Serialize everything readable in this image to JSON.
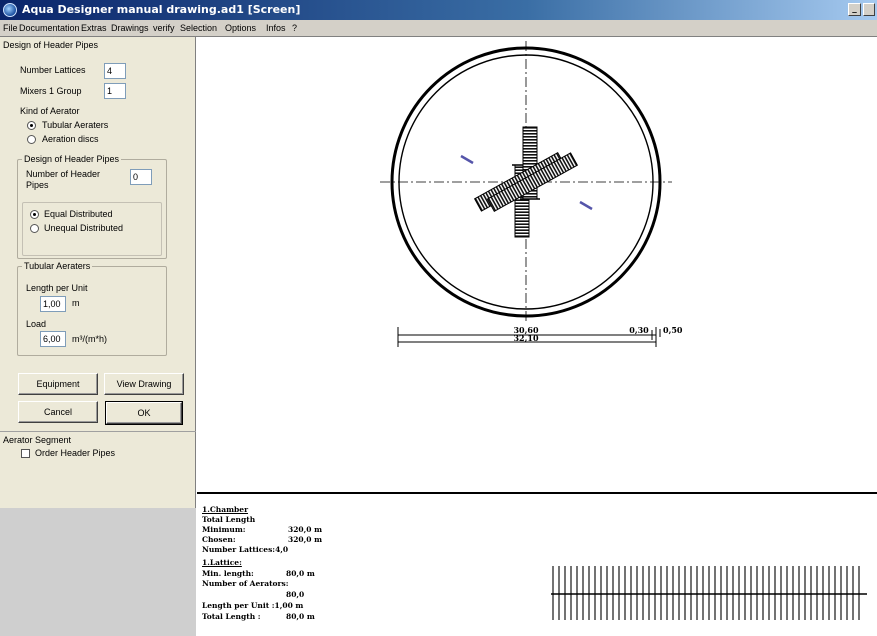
{
  "window": {
    "title": "Aqua Designer manual drawing.ad1   [Screen]",
    "min_glyph": "_"
  },
  "menu": [
    "File",
    "Documentation",
    "Extras",
    "Drawings",
    "verify",
    "Selection",
    "Options",
    "Infos",
    "?"
  ],
  "panel": {
    "heading": "Design of Header Pipes",
    "number_lattices_label": "Number Lattices",
    "number_lattices_value": "4",
    "mixers_label": "Mixers 1 Group",
    "mixers_value": "1",
    "kind_label": "Kind of Aerator",
    "kind_options": [
      {
        "label": "Tubular Aeraters",
        "selected": true
      },
      {
        "label": "Aeration discs",
        "selected": false
      }
    ],
    "header_group": {
      "title": "Design of Header Pipes",
      "number_label_1": "Number of Header",
      "number_label_2": "Pipes",
      "number_value": "0",
      "dist_options": [
        {
          "label": "Equal Distributed",
          "selected": true
        },
        {
          "label": "Unequal Distributed",
          "selected": false
        }
      ]
    },
    "tubular_group": {
      "title": "Tubular Aeraters",
      "length_label": "Length per Unit",
      "length_value": "1,00",
      "length_unit": "m",
      "load_label": "Load",
      "load_value": "6,00",
      "load_unit": "m³/(m*h)"
    },
    "buttons": {
      "equipment": "Equipment",
      "view_drawing": "View Drawing",
      "cancel": "Cancel",
      "ok": "OK"
    },
    "segment": {
      "title": "Aerator Segment",
      "order_label": "Order Header Pipes",
      "order_checked": false
    }
  },
  "drawing": {
    "dim_top_left": "30,60",
    "dim_bottom": "32,10",
    "dim_top_right": "0,30",
    "dim_outer": "0,50"
  },
  "report": {
    "chamber_title": "1.Chamber",
    "total_length_label": "Total Length",
    "minimum_label": "Minimum:",
    "minimum_value": "320,0  m",
    "chosen_label": "Chosen:",
    "chosen_value": "320,0  m",
    "number_lattices_line": "Number Lattices:4,0",
    "lattice_title": "1.Lattice:",
    "min_length_label": "Min. length:",
    "min_length_value": "80,0  m",
    "number_aerators_label": "Number of Aerators:",
    "number_aerators_value": "80,0",
    "length_per_unit_line": "Length per Unit :1,00  m",
    "total_length_line_label": "Total Length :",
    "total_length_line_value": "80,0  m"
  }
}
